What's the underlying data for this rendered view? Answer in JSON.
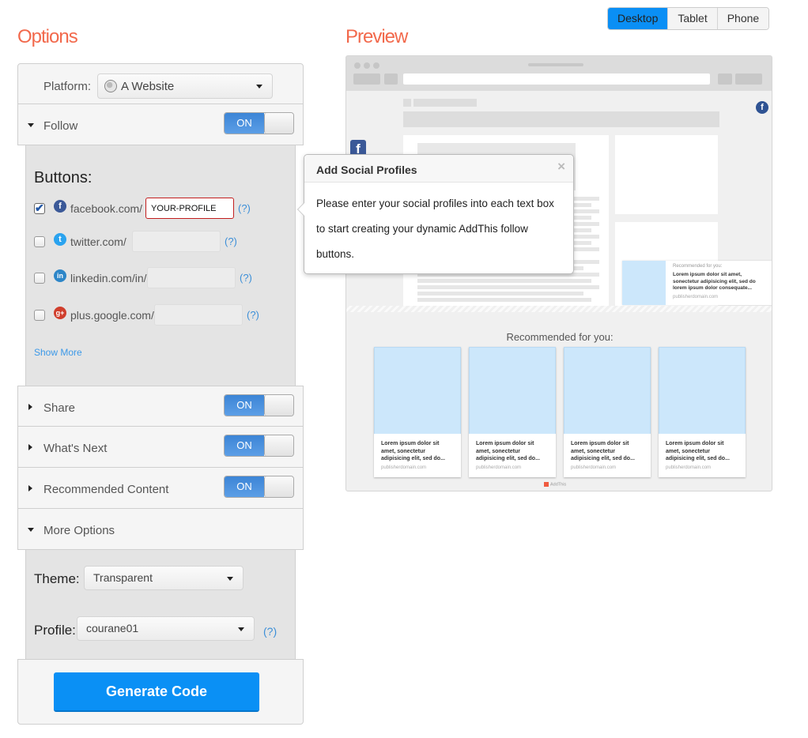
{
  "options": {
    "title": "Options",
    "platform": {
      "label": "Platform:",
      "value": "A Website",
      "icon": "globe-icon"
    },
    "sections": {
      "follow": {
        "label": "Follow",
        "toggle": "ON",
        "expanded": true
      },
      "share": {
        "label": "Share",
        "toggle": "ON",
        "expanded": false
      },
      "whats_next": {
        "label": "What's Next",
        "toggle": "ON",
        "expanded": false
      },
      "recommended": {
        "label": "Recommended Content",
        "toggle": "ON",
        "expanded": false
      },
      "more_options": {
        "label": "More Options",
        "expanded": true
      }
    },
    "follow": {
      "buttons_title": "Buttons:",
      "services": [
        {
          "name": "facebook",
          "icon": "facebook-icon",
          "glyph": "f",
          "color": "#3b5998",
          "label": "facebook.com/",
          "value": "YOUR-PROFILE",
          "checked": true,
          "error": true,
          "help": "(?)"
        },
        {
          "name": "twitter",
          "icon": "twitter-icon",
          "glyph": "t",
          "color": "#2aa3ef",
          "label": "twitter.com/",
          "value": "",
          "checked": false,
          "error": false,
          "help": "(?)"
        },
        {
          "name": "linkedin",
          "icon": "linkedin-icon",
          "glyph": "in",
          "color": "#2d86c8",
          "label": "linkedin.com/in/",
          "value": "",
          "checked": false,
          "error": false,
          "help": "(?)"
        },
        {
          "name": "google-plus",
          "icon": "google-plus-icon",
          "glyph": "g+",
          "color": "#d03e2c",
          "label": "plus.google.com/",
          "value": "",
          "checked": false,
          "error": false,
          "help": "(?)"
        }
      ],
      "show_more": "Show More"
    },
    "more": {
      "theme_label": "Theme:",
      "theme_value": "Transparent",
      "profile_label": "Profile:",
      "profile_value": "courane01",
      "profile_help": "(?)"
    },
    "generate_button": "Generate Code"
  },
  "popover": {
    "title": "Add Social Profiles",
    "close": "×",
    "body": "Please enter your social profiles into each text box to start creating your dynamic AddThis follow buttons."
  },
  "preview": {
    "title": "Preview",
    "device_tabs": [
      {
        "label": "Desktop",
        "active": true
      },
      {
        "label": "Tablet",
        "active": false
      },
      {
        "label": "Phone",
        "active": false
      }
    ],
    "toast": {
      "kicker": "Recommended for you:",
      "title": "Lorem ipsum dolor sit amet, sonectetur adipisicing elit, sed do lorem ipsum dolor consequate...",
      "domain": "publisherdomain.com"
    },
    "recommended_title": "Recommended for you:",
    "cards": [
      {
        "title": "Lorem ipsum dolor sit amet, sonectetur adipisicing elit, sed do...",
        "domain": "publisherdomain.com"
      },
      {
        "title": "Lorem ipsum dolor sit amet, sonectetur adipisicing elit, sed do...",
        "domain": "publisherdomain.com"
      },
      {
        "title": "Lorem ipsum dolor sit amet, sonectetur adipisicing elit, sed do...",
        "domain": "publisherdomain.com"
      },
      {
        "title": "Lorem ipsum dolor sit amet, sonectetur adipisicing elit, sed do...",
        "domain": "publisherdomain.com"
      }
    ],
    "footer_brand": "AddThis"
  }
}
